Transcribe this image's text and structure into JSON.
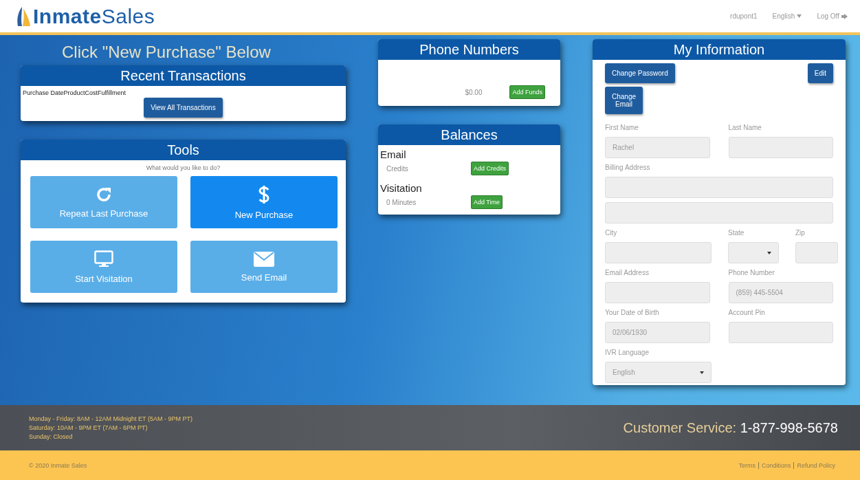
{
  "header": {
    "logo_bold": "Inmate",
    "logo_light": "Sales",
    "nav": [
      {
        "label": "rdupont1",
        "kind": "text"
      },
      {
        "label": "English",
        "kind": "dropdown"
      },
      {
        "label": "Log Off",
        "kind": "logout"
      }
    ]
  },
  "prompt": "Click \"New Purchase\" Below",
  "recent_transactions": {
    "title": "Recent Transactions",
    "columns": [
      "Purchase Date",
      "Product",
      "Cost",
      "Fulfillment"
    ],
    "button": "View All Transactions"
  },
  "tools": {
    "title": "Tools",
    "question": "What would you like to do?",
    "actions": [
      {
        "label": "Repeat Last Purchase",
        "kind": "repeat",
        "selected": false
      },
      {
        "label": "New Purchase",
        "kind": "dollar",
        "selected": true
      },
      {
        "label": "Start Visitation",
        "kind": "monitor",
        "selected": false
      },
      {
        "label": "Send Email",
        "kind": "envelope",
        "selected": false
      }
    ]
  },
  "phone_numbers": {
    "title": "Phone Numbers",
    "balance": "$0.00",
    "button": "Add Funds"
  },
  "balances": {
    "title": "Balances",
    "groups": [
      {
        "heading": "Email",
        "amount": "Credits",
        "button": "Add Credits"
      },
      {
        "heading": "Visitation",
        "amount": "0 Minutes",
        "button": "Add Time"
      }
    ]
  },
  "my_information": {
    "title": "My Information",
    "buttons": [
      {
        "label": "Change Password",
        "kind": "left"
      },
      {
        "label": "Edit",
        "kind": "right"
      },
      {
        "label": "Change Email",
        "kind": "left"
      }
    ],
    "rows": [
      [
        {
          "label": "First Name",
          "value": "Rachel",
          "kind": "text"
        },
        {
          "label": "Last Name",
          "kind": "text"
        }
      ],
      [
        {
          "label": "Billing Address",
          "kind": "text"
        }
      ],
      [
        {
          "kind": "text"
        }
      ],
      [
        {
          "label": "City",
          "kind": "text"
        },
        {
          "label": "State",
          "kind": "select"
        },
        {
          "label": "Zip",
          "kind": "text"
        }
      ],
      [
        {
          "label": "Email Address",
          "kind": "text"
        },
        {
          "label": "Phone Number",
          "value": "(859) 445-5504",
          "kind": "text"
        }
      ],
      [
        {
          "label": "Your Date of Birth",
          "value": "02/06/1930",
          "kind": "text"
        },
        {
          "label": "Account Pin",
          "kind": "text"
        }
      ],
      [
        {
          "label": "IVR Language",
          "value": "English",
          "kind": "select"
        }
      ]
    ]
  },
  "footer": {
    "hours": [
      "Monday - Friday: 8AM - 12AM Midnight ET (5AM - 9PM PT)",
      "Saturday: 10AM - 9PM ET (7AM - 6PM PT)",
      "Sunday: Closed"
    ],
    "service_label": "Customer Service:",
    "service_phone": "1-877-998-5678",
    "copyright": "© 2020 Inmate Sales",
    "links": [
      "Terms",
      "Conditions",
      "Refund Policy"
    ]
  }
}
